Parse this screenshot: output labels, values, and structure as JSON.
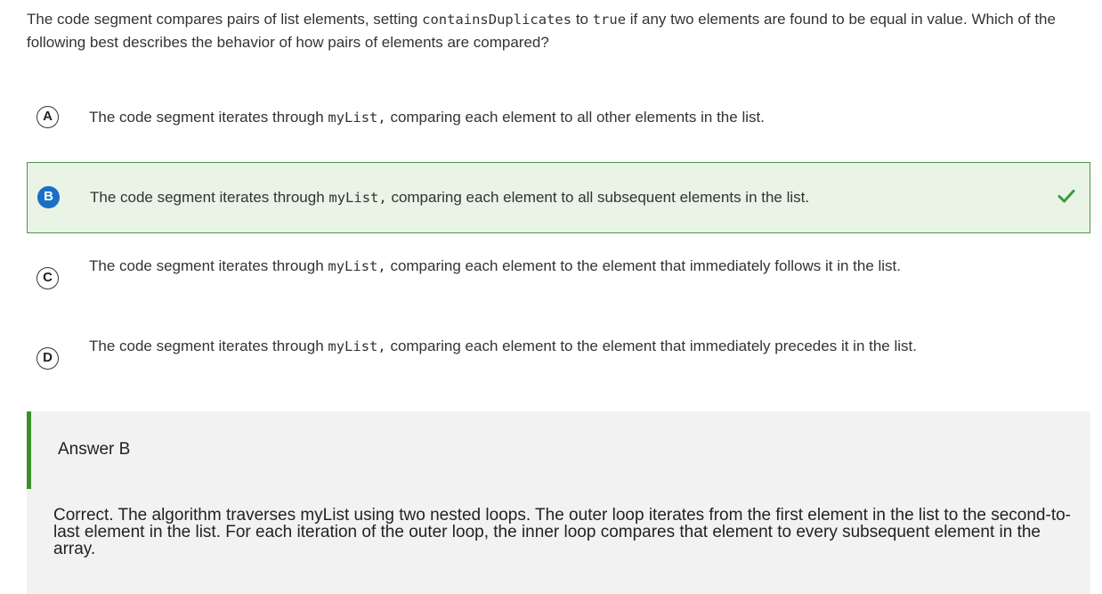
{
  "question": {
    "part1": "The code segment compares pairs of list elements, setting ",
    "code1": "containsDuplicates",
    "part2": " to ",
    "code2": "true",
    "part3": " if any two elements are found to be equal in value. Which of the following best describes the behavior of how pairs of elements are compared?"
  },
  "options": [
    {
      "letter": "A",
      "before": "The code segment iterates through ",
      "code": "myList,",
      "after": " comparing each element to all other elements in the list.",
      "selected": false
    },
    {
      "letter": "B",
      "before": "The code segment iterates through ",
      "code": "myList,",
      "after": " comparing each element to all subsequent elements in the list.",
      "selected": true,
      "correct": true
    },
    {
      "letter": "C",
      "before": "The code segment iterates through ",
      "code": "myList,",
      "after": " comparing each element to the element that immediately follows it in the list.",
      "selected": false
    },
    {
      "letter": "D",
      "before": "The code segment iterates through ",
      "code": "myList,",
      "after": " comparing each element to the element that immediately precedes it in the list.",
      "selected": false
    }
  ],
  "answer": {
    "title": "Answer B",
    "explanation": "Correct. The algorithm traverses myList using two nested loops. The outer loop iterates from the first element in the list to the second-to-last element in the list. For each iteration of the outer loop, the inner loop compares that element to every subsequent element in the array."
  },
  "colors": {
    "selected_bg": "#e9f3e6",
    "selected_border": "#4c9a45",
    "selected_letter_bg": "#1a6fc4",
    "check": "#3a9b3a",
    "answer_bar": "#3a8f2c",
    "answer_bg": "#f2f2f2"
  },
  "icons": {
    "correct": "checkmark-icon"
  }
}
